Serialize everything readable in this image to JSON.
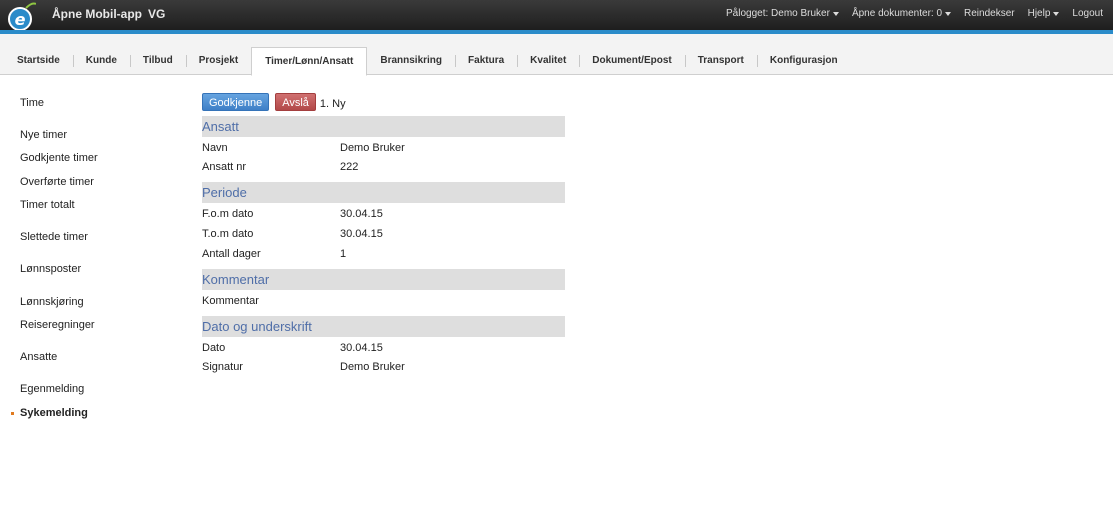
{
  "topbar": {
    "app_link": "Åpne Mobil-app",
    "vg_link": "VG",
    "logged_in": "Pålogget: Demo Bruker",
    "open_docs": "Åpne dokumenter: 0",
    "reindex": "Reindekser",
    "help": "Hjelp",
    "logout": "Logout",
    "accent_color": "#2a8bc9"
  },
  "tabs": [
    {
      "label": "Startside"
    },
    {
      "label": "Kunde"
    },
    {
      "label": "Tilbud"
    },
    {
      "label": "Prosjekt"
    },
    {
      "label": "Timer/Lønn/Ansatt",
      "active": true
    },
    {
      "label": "Brannsikring"
    },
    {
      "label": "Faktura"
    },
    {
      "label": "Kvalitet"
    },
    {
      "label": "Dokument/Epost"
    },
    {
      "label": "Transport"
    },
    {
      "label": "Konfigurasjon"
    }
  ],
  "sidebar": {
    "items": [
      {
        "label": "Time"
      },
      {
        "label": "Nye timer"
      },
      {
        "label": "Godkjente timer"
      },
      {
        "label": "Overførte timer"
      },
      {
        "label": "Timer totalt"
      },
      {
        "label": "Slettede timer"
      },
      {
        "label": "Lønnsposter"
      },
      {
        "label": "Lønnskjøring"
      },
      {
        "label": "Reiseregninger"
      },
      {
        "label": "Ansatte"
      },
      {
        "label": "Egenmelding"
      },
      {
        "label": "Sykemelding",
        "active": true
      }
    ]
  },
  "actions": {
    "approve_label": "Godkjenne",
    "reject_label": "Avslå",
    "status": "1. Ny"
  },
  "sections": {
    "ansatt": {
      "title": "Ansatt",
      "navn_label": "Navn",
      "navn_value": "Demo Bruker",
      "nr_label": "Ansatt nr",
      "nr_value": "222"
    },
    "periode": {
      "title": "Periode",
      "fom_label": "F.o.m dato",
      "fom_value": "30.04.15",
      "tom_label": "T.o.m dato",
      "tom_value": "30.04.15",
      "dager_label": "Antall dager",
      "dager_value": "1"
    },
    "kommentar": {
      "title": "Kommentar",
      "label": "Kommentar"
    },
    "dato": {
      "title": "Dato og underskrift",
      "dato_label": "Dato",
      "dato_value": "30.04.15",
      "sig_label": "Signatur",
      "sig_value": "Demo Bruker"
    }
  }
}
